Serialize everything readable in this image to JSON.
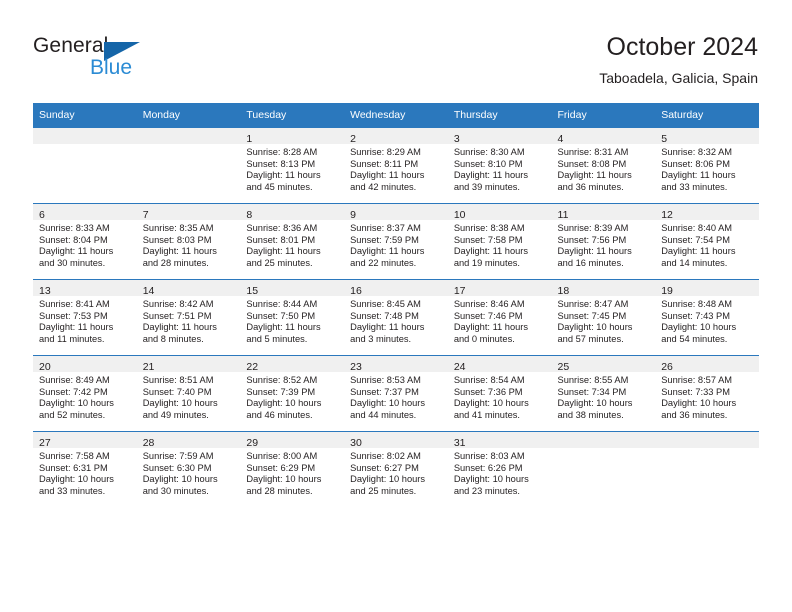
{
  "brand": {
    "line1": "General",
    "line2": "Blue",
    "triangle_icon": "triangle-icon",
    "color_dark": "#231f20",
    "color_blue": "#2b8bd4",
    "color_triangle": "#1565a8"
  },
  "header": {
    "title": "October 2024",
    "subtitle": "Taboadela, Galicia, Spain"
  },
  "colors": {
    "header_row": "#2b78bd",
    "daynum_band": "#f0f0f0",
    "text": "#231f20",
    "cell_bg": "#ffffff"
  },
  "weekday_headers": [
    "Sunday",
    "Monday",
    "Tuesday",
    "Wednesday",
    "Thursday",
    "Friday",
    "Saturday"
  ],
  "weeks": [
    [
      {
        "day": "",
        "lines": []
      },
      {
        "day": "",
        "lines": []
      },
      {
        "day": "1",
        "lines": [
          "Sunrise: 8:28 AM",
          "Sunset: 8:13 PM",
          "Daylight: 11 hours",
          "and 45 minutes."
        ]
      },
      {
        "day": "2",
        "lines": [
          "Sunrise: 8:29 AM",
          "Sunset: 8:11 PM",
          "Daylight: 11 hours",
          "and 42 minutes."
        ]
      },
      {
        "day": "3",
        "lines": [
          "Sunrise: 8:30 AM",
          "Sunset: 8:10 PM",
          "Daylight: 11 hours",
          "and 39 minutes."
        ]
      },
      {
        "day": "4",
        "lines": [
          "Sunrise: 8:31 AM",
          "Sunset: 8:08 PM",
          "Daylight: 11 hours",
          "and 36 minutes."
        ]
      },
      {
        "day": "5",
        "lines": [
          "Sunrise: 8:32 AM",
          "Sunset: 8:06 PM",
          "Daylight: 11 hours",
          "and 33 minutes."
        ]
      }
    ],
    [
      {
        "day": "6",
        "lines": [
          "Sunrise: 8:33 AM",
          "Sunset: 8:04 PM",
          "Daylight: 11 hours",
          "and 30 minutes."
        ]
      },
      {
        "day": "7",
        "lines": [
          "Sunrise: 8:35 AM",
          "Sunset: 8:03 PM",
          "Daylight: 11 hours",
          "and 28 minutes."
        ]
      },
      {
        "day": "8",
        "lines": [
          "Sunrise: 8:36 AM",
          "Sunset: 8:01 PM",
          "Daylight: 11 hours",
          "and 25 minutes."
        ]
      },
      {
        "day": "9",
        "lines": [
          "Sunrise: 8:37 AM",
          "Sunset: 7:59 PM",
          "Daylight: 11 hours",
          "and 22 minutes."
        ]
      },
      {
        "day": "10",
        "lines": [
          "Sunrise: 8:38 AM",
          "Sunset: 7:58 PM",
          "Daylight: 11 hours",
          "and 19 minutes."
        ]
      },
      {
        "day": "11",
        "lines": [
          "Sunrise: 8:39 AM",
          "Sunset: 7:56 PM",
          "Daylight: 11 hours",
          "and 16 minutes."
        ]
      },
      {
        "day": "12",
        "lines": [
          "Sunrise: 8:40 AM",
          "Sunset: 7:54 PM",
          "Daylight: 11 hours",
          "and 14 minutes."
        ]
      }
    ],
    [
      {
        "day": "13",
        "lines": [
          "Sunrise: 8:41 AM",
          "Sunset: 7:53 PM",
          "Daylight: 11 hours",
          "and 11 minutes."
        ]
      },
      {
        "day": "14",
        "lines": [
          "Sunrise: 8:42 AM",
          "Sunset: 7:51 PM",
          "Daylight: 11 hours",
          "and 8 minutes."
        ]
      },
      {
        "day": "15",
        "lines": [
          "Sunrise: 8:44 AM",
          "Sunset: 7:50 PM",
          "Daylight: 11 hours",
          "and 5 minutes."
        ]
      },
      {
        "day": "16",
        "lines": [
          "Sunrise: 8:45 AM",
          "Sunset: 7:48 PM",
          "Daylight: 11 hours",
          "and 3 minutes."
        ]
      },
      {
        "day": "17",
        "lines": [
          "Sunrise: 8:46 AM",
          "Sunset: 7:46 PM",
          "Daylight: 11 hours",
          "and 0 minutes."
        ]
      },
      {
        "day": "18",
        "lines": [
          "Sunrise: 8:47 AM",
          "Sunset: 7:45 PM",
          "Daylight: 10 hours",
          "and 57 minutes."
        ]
      },
      {
        "day": "19",
        "lines": [
          "Sunrise: 8:48 AM",
          "Sunset: 7:43 PM",
          "Daylight: 10 hours",
          "and 54 minutes."
        ]
      }
    ],
    [
      {
        "day": "20",
        "lines": [
          "Sunrise: 8:49 AM",
          "Sunset: 7:42 PM",
          "Daylight: 10 hours",
          "and 52 minutes."
        ]
      },
      {
        "day": "21",
        "lines": [
          "Sunrise: 8:51 AM",
          "Sunset: 7:40 PM",
          "Daylight: 10 hours",
          "and 49 minutes."
        ]
      },
      {
        "day": "22",
        "lines": [
          "Sunrise: 8:52 AM",
          "Sunset: 7:39 PM",
          "Daylight: 10 hours",
          "and 46 minutes."
        ]
      },
      {
        "day": "23",
        "lines": [
          "Sunrise: 8:53 AM",
          "Sunset: 7:37 PM",
          "Daylight: 10 hours",
          "and 44 minutes."
        ]
      },
      {
        "day": "24",
        "lines": [
          "Sunrise: 8:54 AM",
          "Sunset: 7:36 PM",
          "Daylight: 10 hours",
          "and 41 minutes."
        ]
      },
      {
        "day": "25",
        "lines": [
          "Sunrise: 8:55 AM",
          "Sunset: 7:34 PM",
          "Daylight: 10 hours",
          "and 38 minutes."
        ]
      },
      {
        "day": "26",
        "lines": [
          "Sunrise: 8:57 AM",
          "Sunset: 7:33 PM",
          "Daylight: 10 hours",
          "and 36 minutes."
        ]
      }
    ],
    [
      {
        "day": "27",
        "lines": [
          "Sunrise: 7:58 AM",
          "Sunset: 6:31 PM",
          "Daylight: 10 hours",
          "and 33 minutes."
        ]
      },
      {
        "day": "28",
        "lines": [
          "Sunrise: 7:59 AM",
          "Sunset: 6:30 PM",
          "Daylight: 10 hours",
          "and 30 minutes."
        ]
      },
      {
        "day": "29",
        "lines": [
          "Sunrise: 8:00 AM",
          "Sunset: 6:29 PM",
          "Daylight: 10 hours",
          "and 28 minutes."
        ]
      },
      {
        "day": "30",
        "lines": [
          "Sunrise: 8:02 AM",
          "Sunset: 6:27 PM",
          "Daylight: 10 hours",
          "and 25 minutes."
        ]
      },
      {
        "day": "31",
        "lines": [
          "Sunrise: 8:03 AM",
          "Sunset: 6:26 PM",
          "Daylight: 10 hours",
          "and 23 minutes."
        ]
      },
      {
        "day": "",
        "lines": []
      },
      {
        "day": "",
        "lines": []
      }
    ]
  ]
}
